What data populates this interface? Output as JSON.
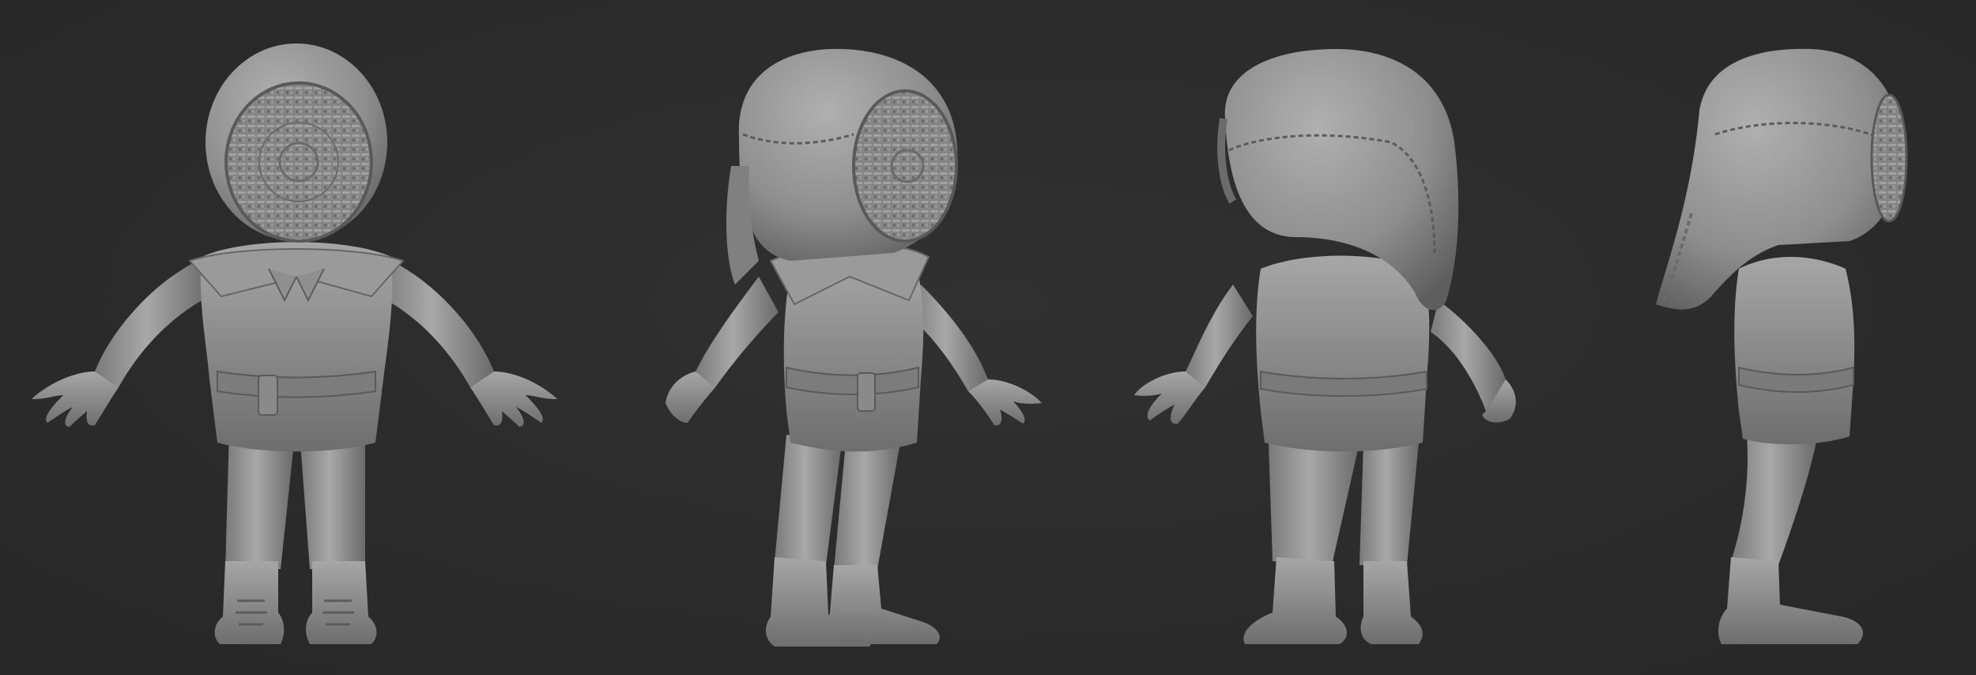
{
  "scene": {
    "background_color": "#2b2b2b",
    "clay_color": "#8c8c8c",
    "views": [
      {
        "name": "front"
      },
      {
        "name": "three-quarter-front"
      },
      {
        "name": "three-quarter-back"
      },
      {
        "name": "side"
      }
    ]
  }
}
